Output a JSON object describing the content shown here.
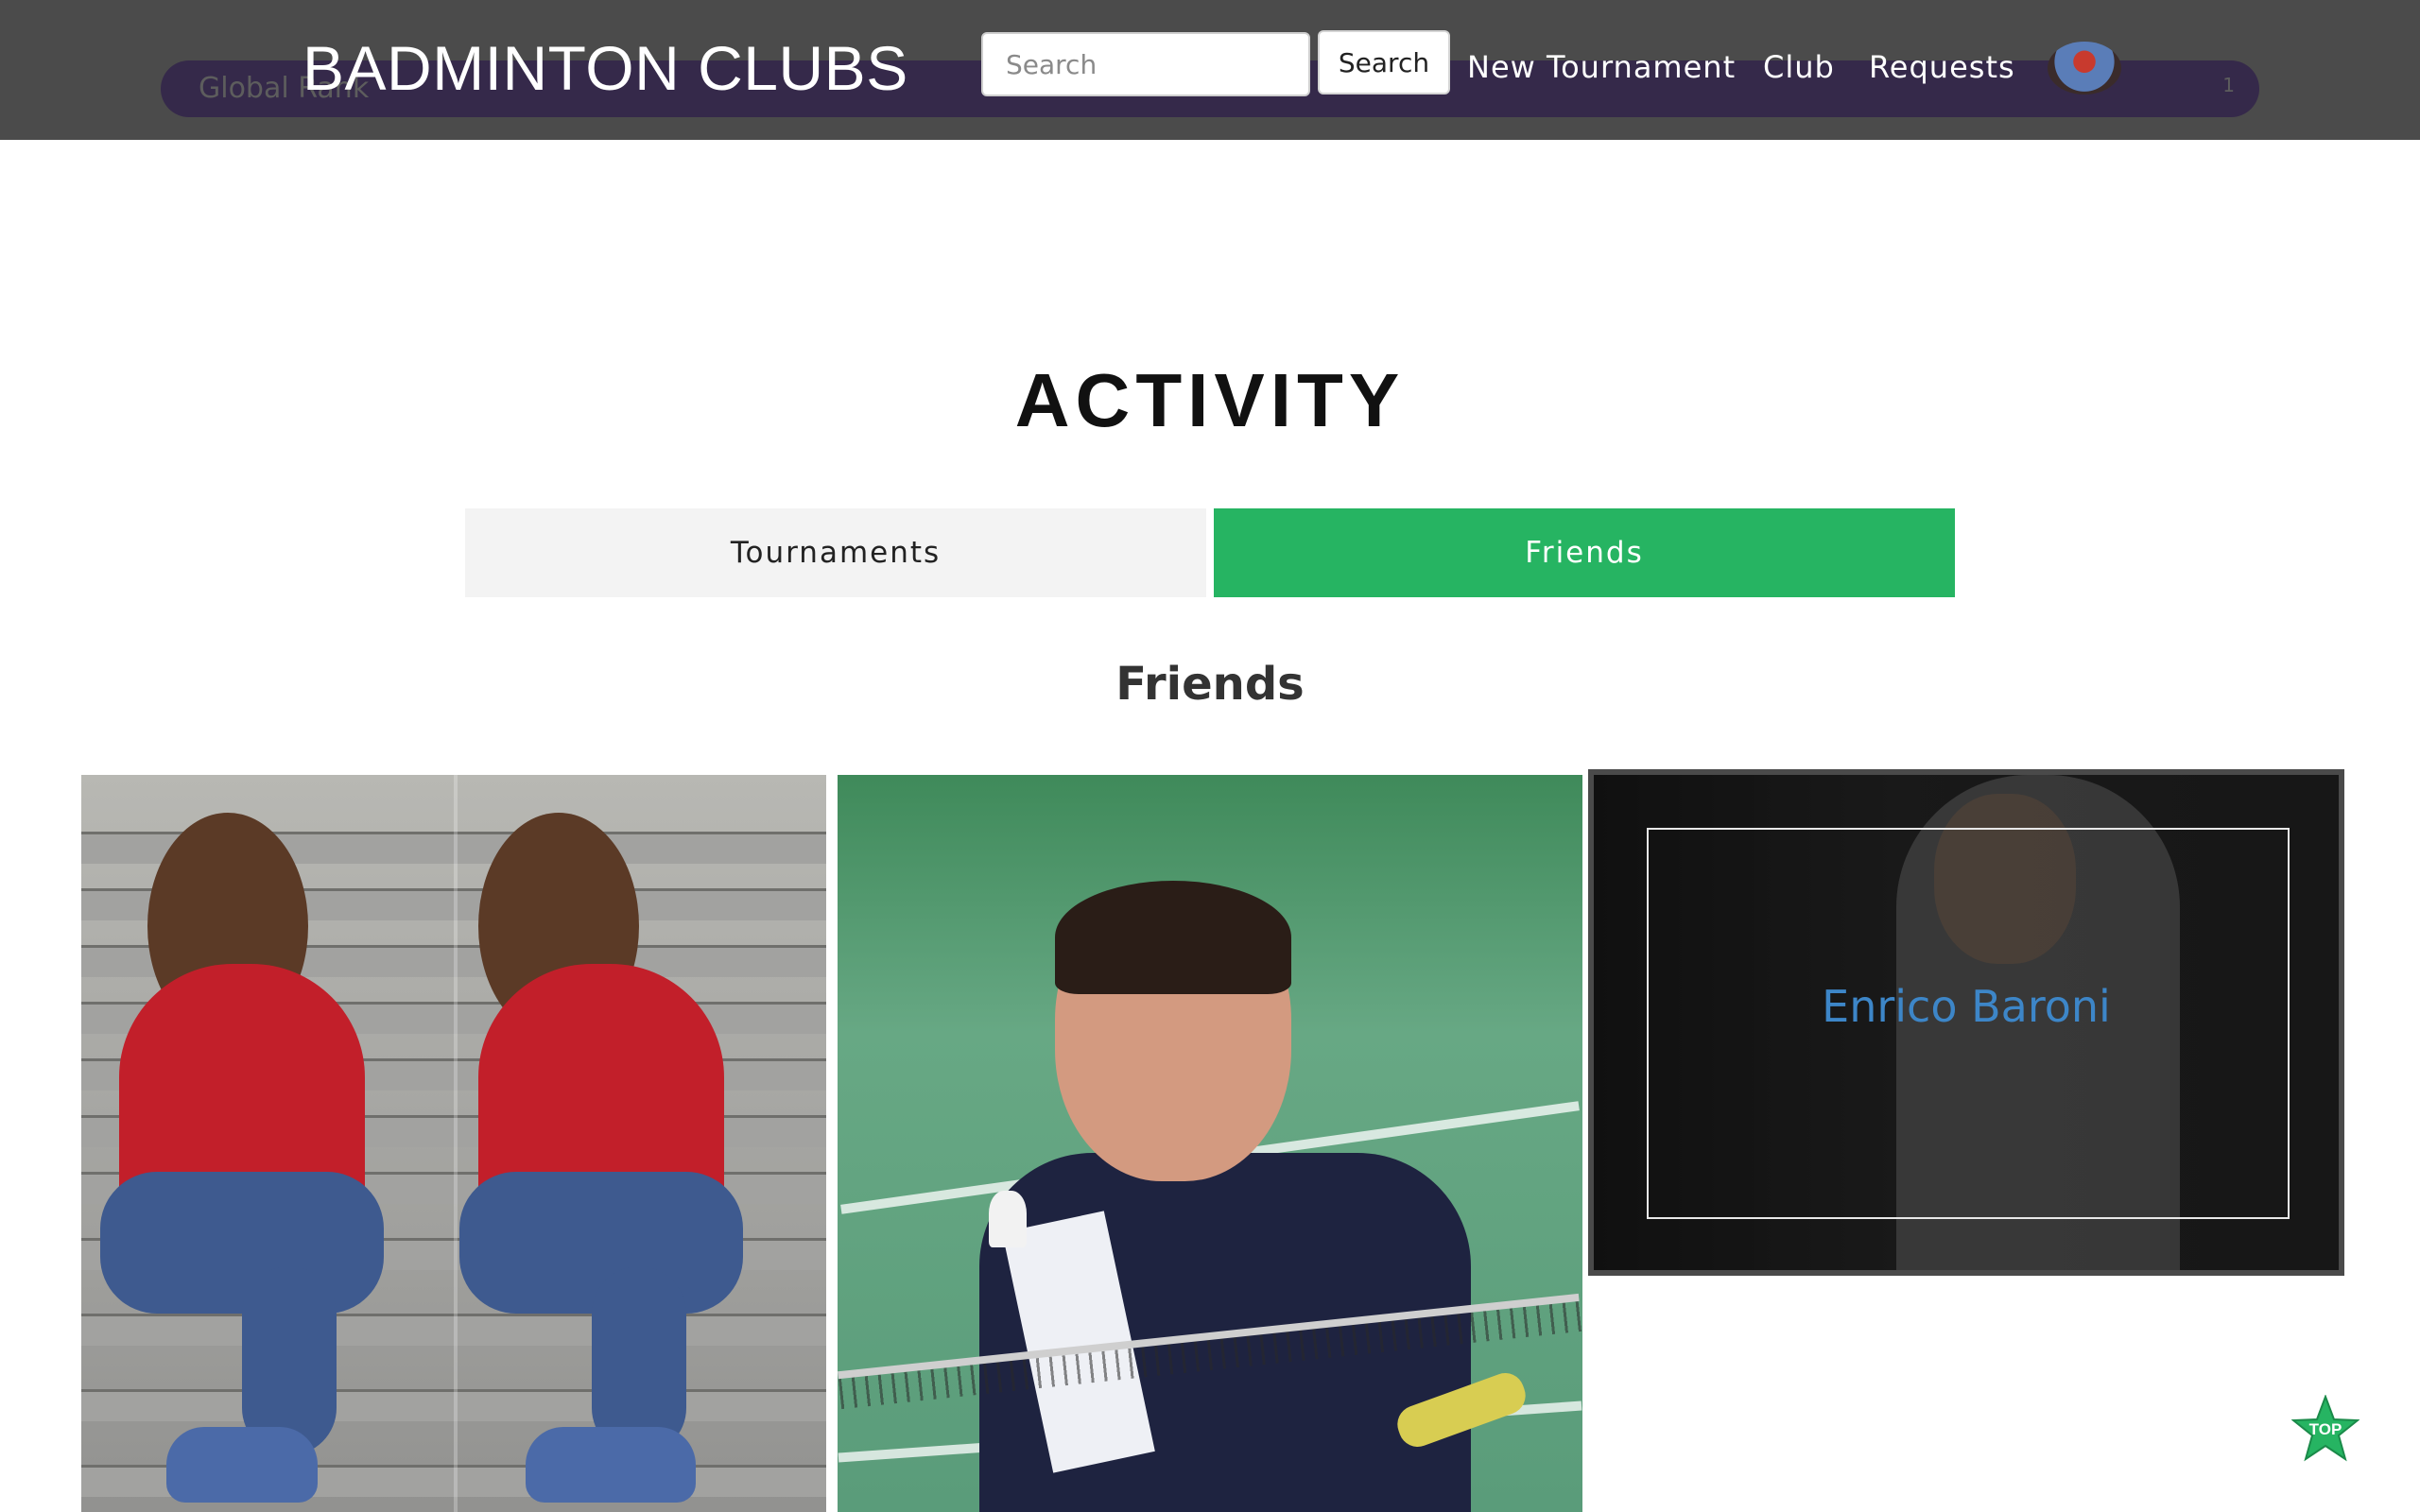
{
  "header": {
    "brand": "BADMINTON CLUBS",
    "rank_label": "Global Rank",
    "rank_value": "1",
    "search_placeholder": "Search",
    "search_button": "Search",
    "nav": [
      {
        "label": "New Tournament"
      },
      {
        "label": "Club"
      },
      {
        "label": "Requests"
      }
    ],
    "avatar_icon": "user-avatar"
  },
  "activity": {
    "title": "ACTIVITY",
    "tabs": [
      {
        "label": "Tournaments",
        "active": false
      },
      {
        "label": "Friends",
        "active": true
      }
    ],
    "section_title": "Friends",
    "friends": [
      {
        "name": "",
        "photo": "woman-red-top-stairs"
      },
      {
        "name": "",
        "photo": "badminton-player-smash"
      },
      {
        "name": "Enrico Baroni",
        "photo": "player-white-jacket",
        "hovered": true
      }
    ]
  },
  "top_button": {
    "label": "TOP",
    "color": "#26b462"
  },
  "colors": {
    "header_bg": "#4b4b4b",
    "rank_bar": "#35294a",
    "active_tab": "#26b462",
    "name_link": "#3d86c8"
  }
}
